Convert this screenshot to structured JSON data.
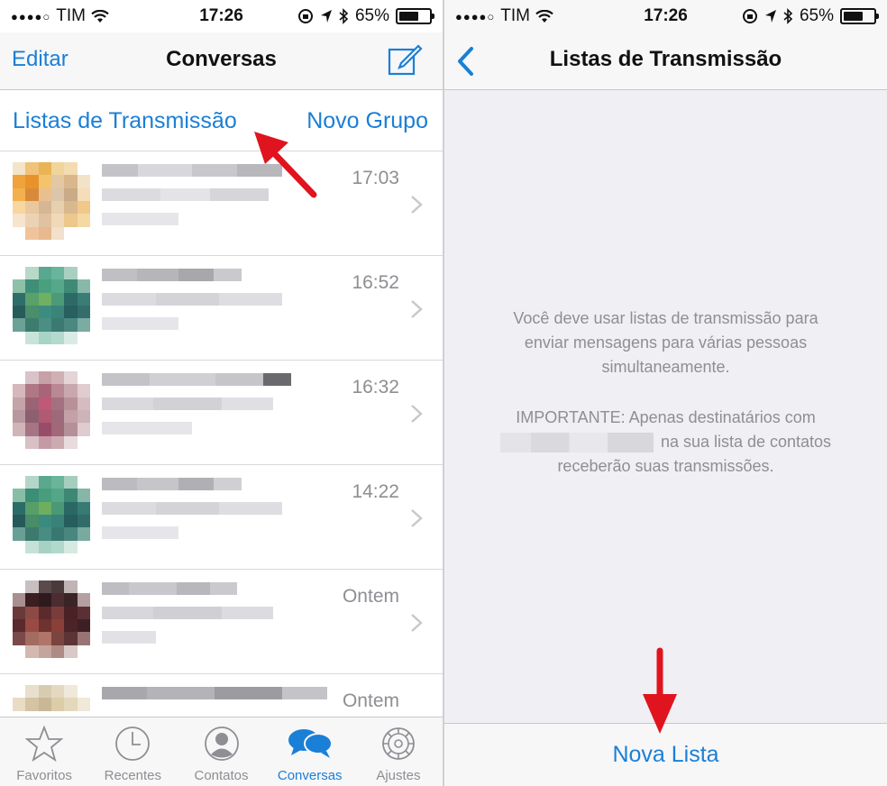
{
  "status": {
    "carrier": "TIM",
    "time": "17:26",
    "battery": "65%",
    "battery_level": 0.65
  },
  "left": {
    "nav": {
      "edit_label": "Editar",
      "title": "Conversas",
      "compose_icon": "compose-icon"
    },
    "actions": {
      "broadcast_label": "Listas de Transmissão",
      "new_group_label": "Novo Grupo"
    },
    "chats": [
      {
        "time": "17:03"
      },
      {
        "time": "16:52"
      },
      {
        "time": "16:32"
      },
      {
        "time": "14:22"
      },
      {
        "time": "Ontem"
      },
      {
        "time": "Ontem"
      }
    ],
    "tabs": [
      {
        "label": "Favoritos",
        "icon": "star-icon"
      },
      {
        "label": "Recentes",
        "icon": "clock-icon"
      },
      {
        "label": "Contatos",
        "icon": "contact-icon"
      },
      {
        "label": "Conversas",
        "icon": "chat-bubbles-icon",
        "active": true
      },
      {
        "label": "Ajustes",
        "icon": "gear-icon"
      }
    ]
  },
  "right": {
    "nav": {
      "title": "Listas de Transmissão"
    },
    "info_line1": "Você deve usar listas de transmissão para",
    "info_line2": "enviar mensagens para várias pessoas",
    "info_line3": "simultaneamente.",
    "important_line1": "IMPORTANTE: Apenas destinatários com",
    "important_line2": "na sua lista de contatos",
    "important_line3": "receberão suas transmissões.",
    "new_list_label": "Nova Lista"
  },
  "colors": {
    "accent": "#1a7fd6",
    "annotation_arrow": "#e0141e",
    "muted": "#8e8e93"
  }
}
